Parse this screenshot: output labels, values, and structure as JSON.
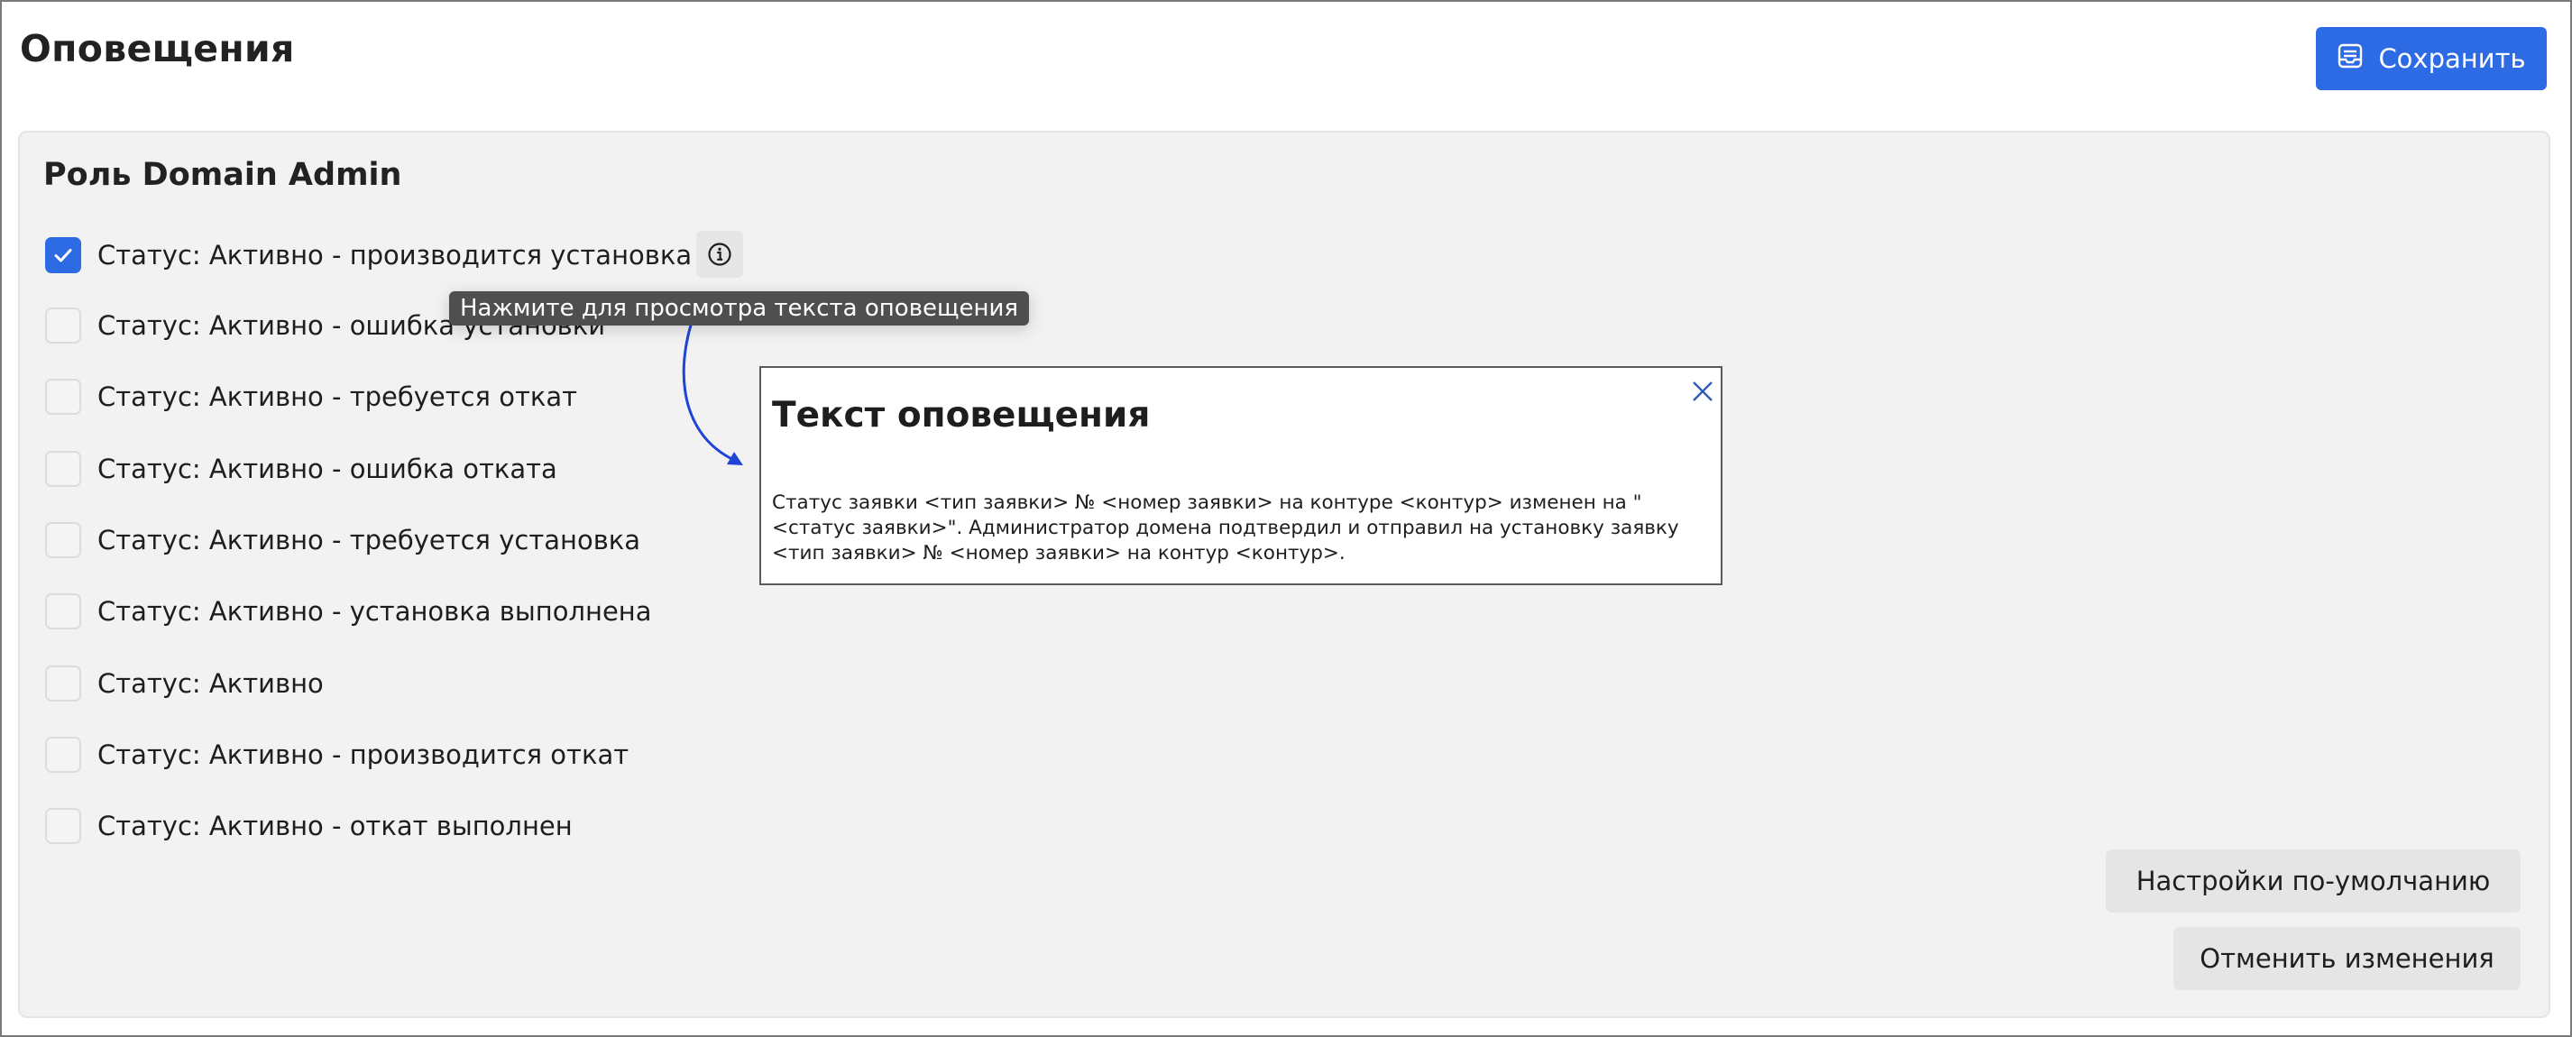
{
  "header": {
    "title": "Оповещения",
    "save_label": "Сохранить"
  },
  "role": {
    "title": "Роль Domain Admin"
  },
  "options": [
    {
      "label": "Статус: Активно - производится установка",
      "checked": true
    },
    {
      "label": "Статус: Активно - ошибка установки",
      "checked": false
    },
    {
      "label": "Статус: Активно - требуется откат",
      "checked": false
    },
    {
      "label": "Статус: Активно - ошибка отката",
      "checked": false
    },
    {
      "label": "Статус: Активно - требуется установка",
      "checked": false
    },
    {
      "label": "Статус: Активно - установка выполнена",
      "checked": false
    },
    {
      "label": "Статус: Активно",
      "checked": false
    },
    {
      "label": "Статус: Активно - производится откат",
      "checked": false
    },
    {
      "label": "Статус: Активно - откат выполнен",
      "checked": false
    }
  ],
  "tooltip": {
    "text": "Нажмите для просмотра текста оповещения"
  },
  "popup": {
    "title": "Текст оповещения",
    "body": "Статус заявки <тип заявки> № <номер заявки> на контуре <контур> изменен на \"<статус заявки>\". Администратор домена подтвердил и отправил на установку заявку <тип заявки> № <номер заявки> на контур <контур>."
  },
  "actions": {
    "defaults_label": "Настройки по-умолчанию",
    "cancel_label": "Отменить изменения"
  },
  "colors": {
    "accent": "#2d6be4",
    "arrow": "#1f45d8",
    "tooltip_bg": "#4f4f4f",
    "panel_bg": "#f2f2f2"
  },
  "icons": {
    "save": "save-list-icon",
    "info": "info-circle-icon",
    "close": "close-icon",
    "check": "checkmark-icon"
  }
}
